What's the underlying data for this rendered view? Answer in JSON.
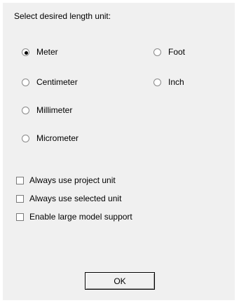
{
  "dialog": {
    "prompt": "Select desired length unit:",
    "units": [
      {
        "label": "Meter",
        "checked": true
      },
      {
        "label": "Centimeter",
        "checked": false
      },
      {
        "label": "Millimeter",
        "checked": false
      },
      {
        "label": "Micrometer",
        "checked": false
      },
      {
        "label": "Foot",
        "checked": false
      },
      {
        "label": "Inch",
        "checked": false
      }
    ],
    "options": [
      {
        "label": "Always use project unit",
        "checked": false
      },
      {
        "label": "Always use selected unit",
        "checked": false
      },
      {
        "label": "Enable large model support",
        "checked": false
      }
    ],
    "ok_label": "OK"
  }
}
